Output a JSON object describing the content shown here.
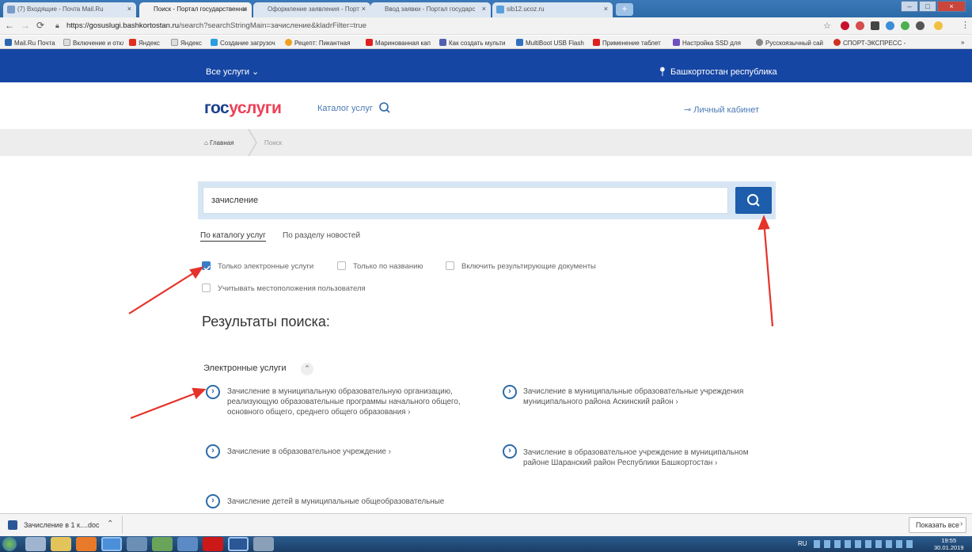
{
  "browser": {
    "tabs": [
      "(7) Входящие - Почта Mail.Ru",
      "Поиск - Портал государственны",
      "Оформление заявления - Порт",
      "Ввод заявки - Портал государс",
      "sib12.ucoz.ru"
    ],
    "tab_close": "×",
    "new_tab": "+",
    "url_domain": "https://gosuslugi.bashkortostan.ru",
    "url_path": "/search?searchStringMain=зачисление&kladrFilter=true",
    "bookmarks": [
      "Mail.Ru Почта",
      "Включение и отклю",
      "Яндекс",
      "Яндекс",
      "Создание загрузоч",
      "Рецепт: Пикантная",
      "Маринованная кап",
      "Как создать мульти",
      "MultiBoot USB Flash",
      "Применение таблет",
      "Настройка SSD для",
      "Русскоязычный сай",
      "СПОРТ-ЭКСПРЕСС -"
    ],
    "more_bookmarks": "»"
  },
  "site": {
    "all_services": "Все услуги",
    "region": "Башкортостан республика",
    "logo_part1": "гос",
    "logo_part2": "услуги",
    "catalog": "Каталог услуг",
    "cabinet": "Личный кабинет",
    "breadcrumb_home": "Главная",
    "breadcrumb_current": "Поиск"
  },
  "search": {
    "query": "зачисление",
    "tab_catalog": "По каталогу услуг",
    "tab_news": "По разделу новостей",
    "options": [
      {
        "label": "Только электронные услуги",
        "checked": true
      },
      {
        "label": "Только по названию",
        "checked": false
      },
      {
        "label": "Включить результирующие документы",
        "checked": false
      },
      {
        "label": "Учитывать местоположения пользователя",
        "checked": false
      }
    ],
    "results_title": "Результаты поиска:",
    "section_title": "Электронные услуги",
    "results": [
      {
        "lines": [
          "Зачисление в муниципальную образовательную организацию,",
          "реализующую образовательные программы начального общего,",
          "основного общего, среднего общего образования ›"
        ]
      },
      {
        "lines": [
          "Зачисление в муниципальные образовательные учреждения",
          "муниципального района Аскинский район ›"
        ]
      },
      {
        "lines": [
          "Зачисление в образовательное учреждение ›"
        ]
      },
      {
        "lines": [
          "Зачисление в образовательное учреждение в муниципальном",
          "районе Шаранский район Республики Башкортостан ›"
        ]
      },
      {
        "lines": [
          "Зачисление детей в муниципальные общеобразовательные"
        ]
      }
    ]
  },
  "download": {
    "file": "Зачисление в 1 к....doc",
    "show_all": "Показать все"
  },
  "taskbar": {
    "lang": "RU",
    "time": "19:55",
    "date": "30.01.2019"
  },
  "colors": {
    "topnav": "#1646a4",
    "search_button": "#1d5dab",
    "accent_red": "#ee3f58",
    "arrow": "#e5332a"
  }
}
